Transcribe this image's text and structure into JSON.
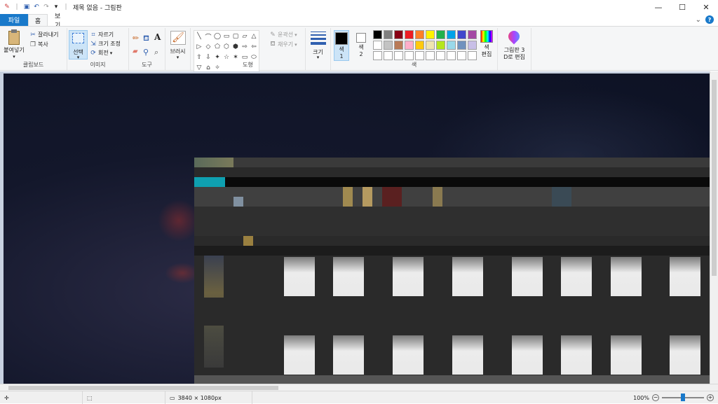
{
  "window": {
    "title": "제목 없음 - 그림판",
    "controls": {
      "minimize": "—",
      "maximize": "☐",
      "close": "✕"
    }
  },
  "qat": {
    "save_icon": "save-icon",
    "undo_icon": "undo-icon",
    "redo_icon": "redo-icon",
    "dropdown": "▾",
    "separator": "|"
  },
  "tabs": [
    {
      "label": "파일"
    },
    {
      "label": "홈"
    },
    {
      "label": "보기"
    }
  ],
  "help": {
    "collapse": "⌄",
    "help": "?"
  },
  "ribbon": {
    "clipboard": {
      "paste": "붙여넣기",
      "cut": "잘라내기",
      "copy": "복사",
      "label": "클립보드"
    },
    "image": {
      "select": "선택",
      "crop": "자르기",
      "resize": "크기 조정",
      "rotate": "회전",
      "label": "이미지"
    },
    "tools": {
      "label": "도구",
      "text_glyph": "A"
    },
    "brushes": {
      "label": "브러시"
    },
    "shapes": {
      "outline": "윤곽선",
      "fill": "채우기",
      "label": "도형",
      "glyphs": [
        "╲",
        "⌒",
        "◯",
        "▭",
        "▢",
        "▱",
        "△",
        "▷",
        "◇",
        "⬠",
        "⬡",
        "⬢",
        "⇨",
        "⇦",
        "⇧",
        "⇩",
        "✦",
        "☆",
        "✶",
        "▭",
        "⬭",
        "▽",
        "⌂",
        "✧"
      ]
    },
    "size": {
      "label": "크기"
    },
    "colors": {
      "color1": "색\n1",
      "color1_l1": "색",
      "color1_l2": "1",
      "color2_l1": "색",
      "color2_l2": "2",
      "edit_l1": "색",
      "edit_l2": "편집",
      "label": "색",
      "palette": [
        "#000000",
        "#7f7f7f",
        "#880015",
        "#ed1c24",
        "#ff7f27",
        "#fff200",
        "#22b14c",
        "#00a2e8",
        "#3f48cc",
        "#a349a4",
        "#ffffff",
        "#c3c3c3",
        "#b97a57",
        "#ffaec9",
        "#ffc90e",
        "#efe4b0",
        "#b5e61d",
        "#99d9ea",
        "#7092be",
        "#c8bfe7",
        "#ffffff",
        "#ffffff",
        "#ffffff",
        "#ffffff",
        "#ffffff",
        "#ffffff",
        "#ffffff",
        "#ffffff",
        "#ffffff",
        "#ffffff"
      ]
    },
    "paint3d": {
      "l1": "그림판 3",
      "l2": "D로 편집"
    }
  },
  "status": {
    "dimensions": "3840 × 1080px",
    "zoom": "100%",
    "zoom_out": "−",
    "zoom_in": "+",
    "zoom_fraction": 0.5
  }
}
